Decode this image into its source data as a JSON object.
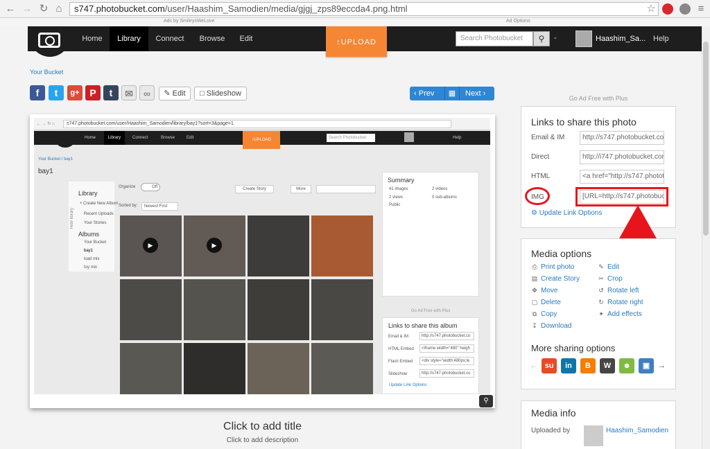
{
  "browser": {
    "url_domain": "s747.photobucket.com",
    "url_path": "/user/Haashim_Samodien/media/gjgj_zps89eccda4.png.html"
  },
  "ads": {
    "left": "Ads by SmileysWeLove",
    "right": "Ad Options"
  },
  "nav": {
    "items": [
      "Home",
      "Library",
      "Connect",
      "Browse",
      "Edit"
    ],
    "upload": "↑UPLOAD",
    "search_placeholder": "Search Photobucket",
    "username": "Haashim_Sa...",
    "help": "Help"
  },
  "breadcrumb": "Your Bucket",
  "toolbar": {
    "edit": "Edit",
    "slideshow": "Slideshow",
    "prev": "Prev",
    "next": "Next"
  },
  "ad_free": "Go Ad Free with Plus",
  "photo": {
    "title": "Click to add title",
    "description": "Click to add description"
  },
  "inner": {
    "url": "s747.photobucket.com/user/Haashim_Samodien/library/bay1?sort=3&page=1",
    "nav": [
      "Home",
      "Library",
      "Connect",
      "Browse",
      "Edit"
    ],
    "upload": "↑UPLOAD",
    "search": "Search Photobucket",
    "help": "Help",
    "breadcrumb": "Your Bucket  /  bay1",
    "album_title": "bay1",
    "library": "Library",
    "create_album": "+ Create New Album",
    "recent_uploads": "Recent Uploads",
    "your_stories": "Your Stories",
    "albums": "Albums",
    "album_list": [
      "Your Bucket",
      "bay1",
      "load mix",
      "toy mix"
    ],
    "organize": "Organize",
    "off": "Off",
    "create_story": "Create Story",
    "more": "More",
    "sorted_by": "Sorted by:",
    "sort_value": "Newest First",
    "hide_library": "Hide library",
    "summary": {
      "title": "Summary",
      "images": "41 images",
      "videos": "2 videos",
      "views": "2 views",
      "subalbums": "0 sub-albums",
      "public": "Public"
    },
    "ad_free": "Go Ad Free with Plus",
    "share_album": {
      "title": "Links to share this album",
      "fields": [
        {
          "label": "Email & IM",
          "value": "http://s747.photobucket.co"
        },
        {
          "label": "HTML Embed",
          "value": "<iframe width=\"480\" heigh"
        },
        {
          "label": "Flash Embed",
          "value": "<div style=\"width:480px;te"
        },
        {
          "label": "Slideshow",
          "value": "http://s747.photobucket.co"
        }
      ],
      "update": "Update Link Options"
    }
  },
  "links_panel": {
    "title": "Links to share this photo",
    "fields": [
      {
        "label": "Email & IM",
        "value": "http://s747.photobucket.co"
      },
      {
        "label": "Direct",
        "value": "http://i747.photobucket.cor"
      },
      {
        "label": "HTML",
        "value": "<a href=\"http://s747.photot"
      },
      {
        "label": "IMG",
        "value": "[URL=http://s747.photobuc"
      }
    ],
    "update": "Update Link Options"
  },
  "media_options": {
    "title": "Media options",
    "left": [
      {
        "label": "Print photo",
        "icon": "printer-icon"
      },
      {
        "label": "Create Story",
        "icon": "story-icon"
      },
      {
        "label": "Move",
        "icon": "move-icon"
      },
      {
        "label": "Delete",
        "icon": "trash-icon"
      },
      {
        "label": "Copy",
        "icon": "copy-icon"
      },
      {
        "label": "Download",
        "icon": "download-icon"
      }
    ],
    "right": [
      {
        "label": "Edit",
        "icon": "edit-icon"
      },
      {
        "label": "Crop",
        "icon": "crop-icon"
      },
      {
        "label": "Rotate left",
        "icon": "rotate-left-icon"
      },
      {
        "label": "Rotate right",
        "icon": "rotate-right-icon"
      },
      {
        "label": "Add effects",
        "icon": "effects-icon"
      }
    ],
    "more_sharing": "More sharing options"
  },
  "media_info": {
    "title": "Media info",
    "uploaded_by": "Uploaded by",
    "user": "Haashim_Samodien"
  },
  "colors": {
    "accent_orange": "#f58634",
    "link_blue": "#2a7ac0",
    "annotation_red": "#e8141c",
    "nav_dark": "#1e1e1e"
  }
}
